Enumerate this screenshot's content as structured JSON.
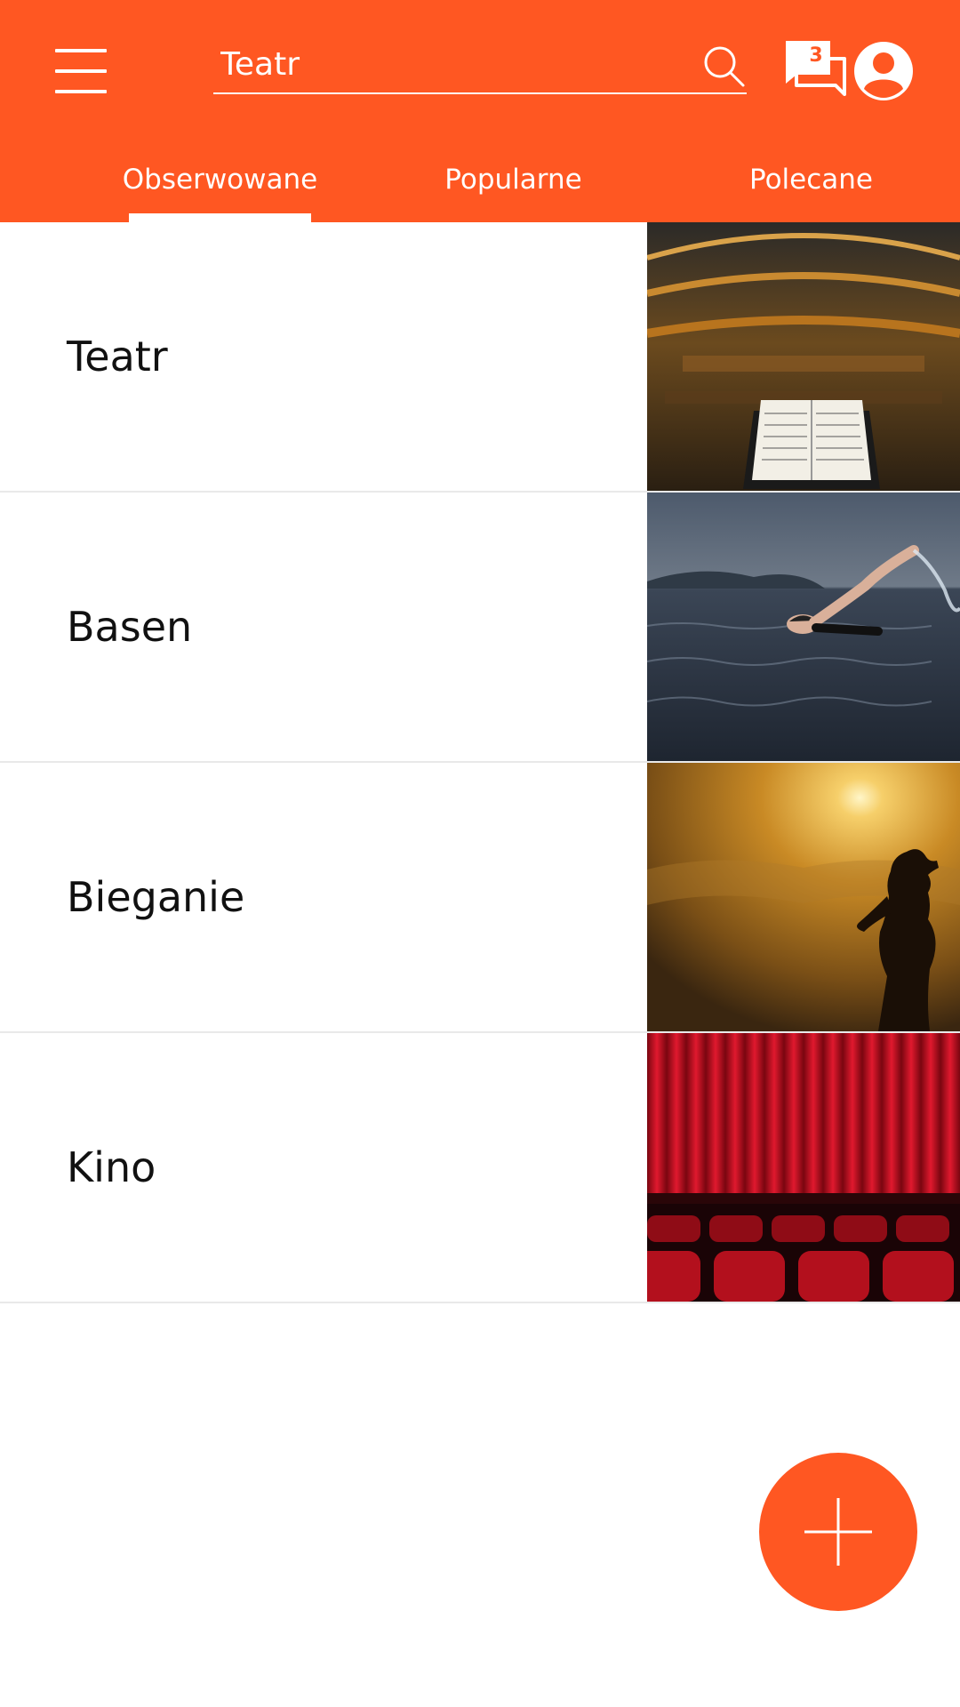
{
  "header": {
    "search": {
      "value": "Teatr",
      "placeholder": ""
    },
    "notifications": {
      "count": "3"
    }
  },
  "tabs": [
    {
      "label": "Obserwowane",
      "active": true
    },
    {
      "label": "Popularne",
      "active": false
    },
    {
      "label": "Polecane",
      "active": false
    }
  ],
  "list": {
    "items": [
      {
        "label": "Teatr"
      },
      {
        "label": "Basen"
      },
      {
        "label": "Bieganie"
      },
      {
        "label": "Kino"
      }
    ]
  },
  "colors": {
    "accent": "#FF5722"
  },
  "icons": [
    "menu-icon",
    "search-icon",
    "chat-icon",
    "account-icon",
    "plus-icon"
  ]
}
